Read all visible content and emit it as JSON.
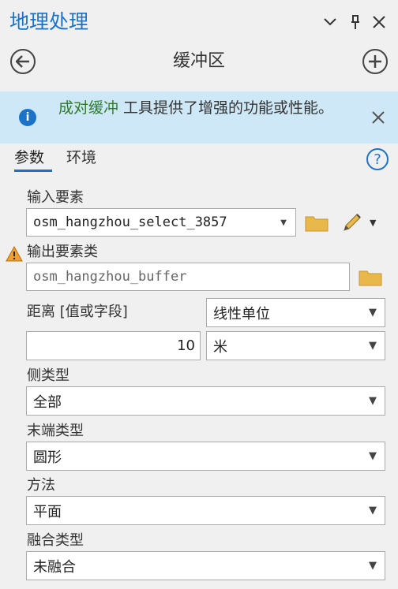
{
  "pane": {
    "title": "地理处理",
    "controls": {
      "dropdown": "⌄",
      "pin": "⊣",
      "close": "✕"
    }
  },
  "tool": {
    "title": "缓冲区"
  },
  "info": {
    "link": "成对缓冲",
    "text": " 工具提供了增强的功能或性能。"
  },
  "tabs": {
    "params": "参数",
    "env": "环境"
  },
  "help": "?",
  "params": {
    "input_label": "输入要素",
    "input_value": "osm_hangzhou_select_3857",
    "output_label": "输出要素类",
    "output_value": "osm_hangzhou_buffer",
    "distance_label": "距离 [值或字段]",
    "distance_type": "线性单位",
    "distance_value": "10",
    "distance_unit": "米",
    "side_label": "侧类型",
    "side_value": "全部",
    "end_label": "末端类型",
    "end_value": "圆形",
    "method_label": "方法",
    "method_value": "平面",
    "dissolve_label": "融合类型",
    "dissolve_value": "未融合"
  },
  "colors": {
    "accent": "#1a73c8",
    "info_bg": "#cfe8f7",
    "link": "#2d7a2d",
    "folder": "#e8b84a",
    "warning": "#f0a030"
  }
}
